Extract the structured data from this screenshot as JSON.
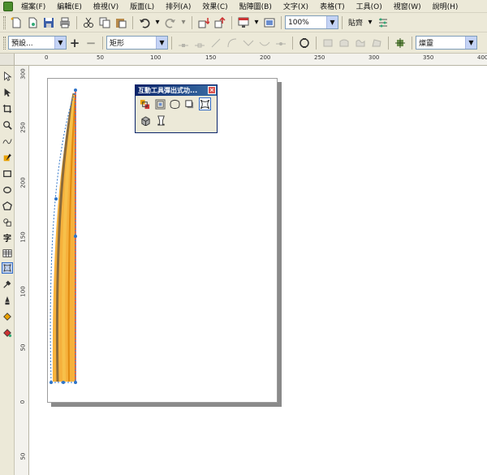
{
  "menu": {
    "items": [
      "檔案(F)",
      "編輯(E)",
      "檢視(V)",
      "版面(L)",
      "排列(A)",
      "效果(C)",
      "點陣圖(B)",
      "文字(X)",
      "表格(T)",
      "工具(O)",
      "視窗(W)",
      "說明(H)"
    ]
  },
  "toolbar1": {
    "zoom_value": "100%",
    "snap_label": "貼齊"
  },
  "toolbar2": {
    "preset_value": "預設...",
    "shape_value": "矩形",
    "mode_value": "燦靈"
  },
  "ruler_h": {
    "labels": [
      "0",
      "50",
      "100",
      "150",
      "200",
      "250",
      "300",
      "350",
      "400"
    ]
  },
  "ruler_v": {
    "labels": [
      "300",
      "250",
      "200",
      "150",
      "100",
      "50",
      "0",
      "50"
    ]
  },
  "toolbox": {
    "text_tool_label": "字"
  },
  "popup": {
    "title": "互動工具彈出式功..."
  },
  "colors": {
    "ui_bg": "#ece9d8",
    "popup_title": "#0a246a",
    "shape_orange": "#f4a31a",
    "shape_brown": "#8a6a3a",
    "selection_blue": "#2e74c9"
  }
}
